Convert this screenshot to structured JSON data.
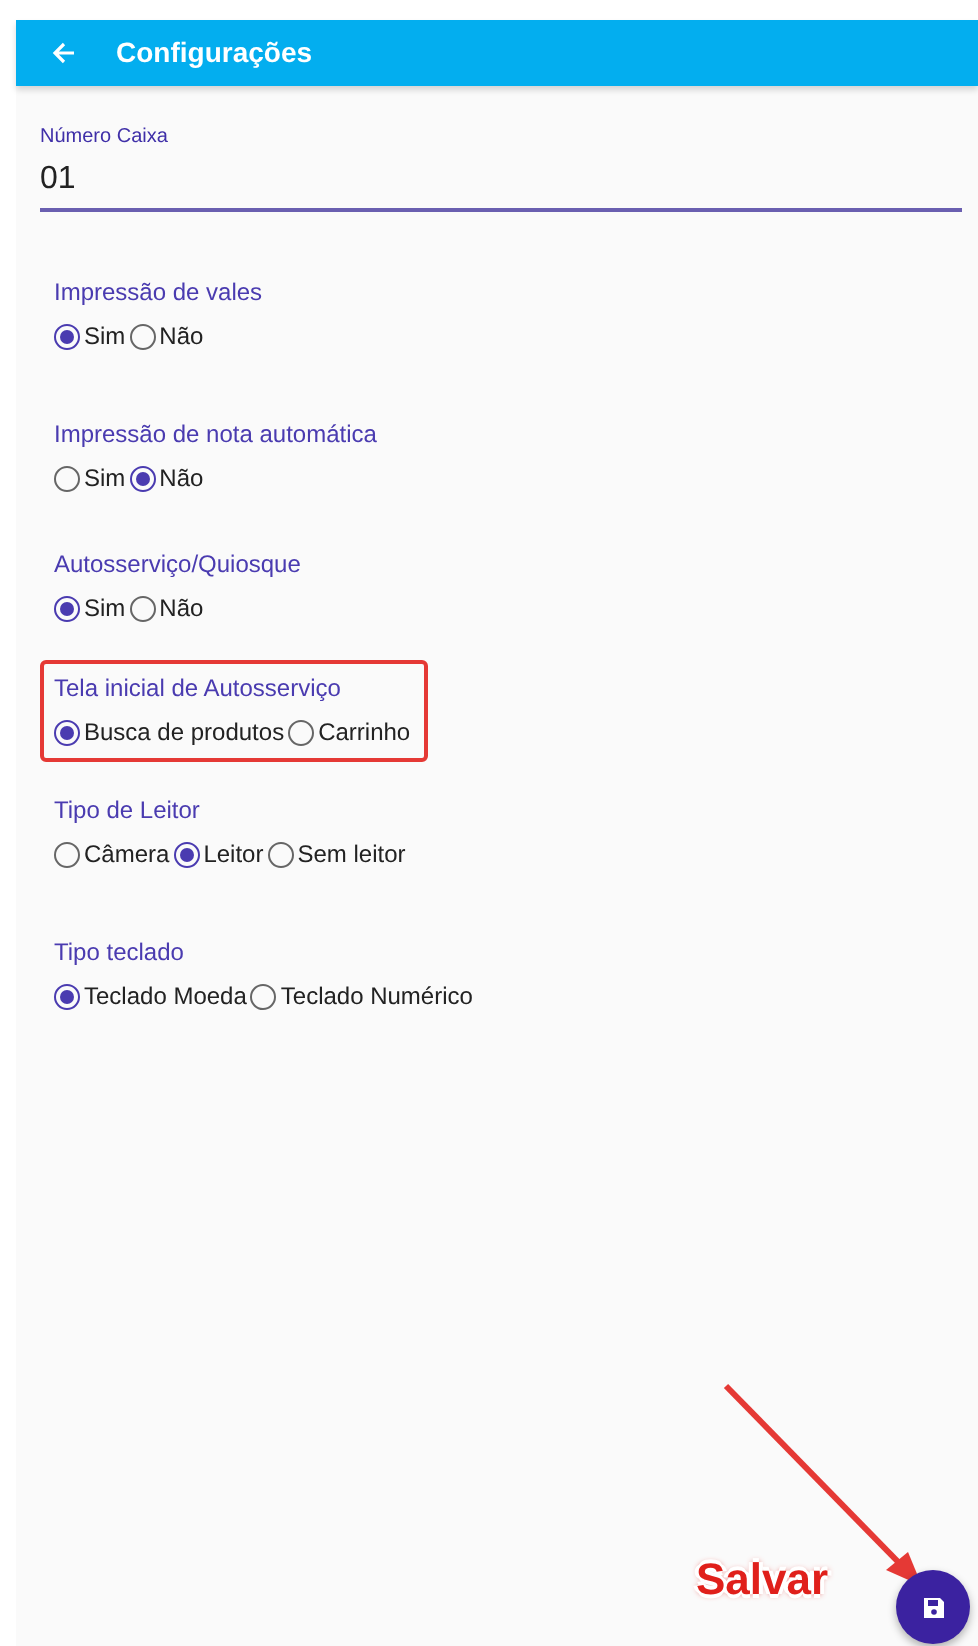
{
  "app_bar": {
    "title": "Configurações"
  },
  "field": {
    "label": "Número Caixa",
    "value": "01"
  },
  "groups": [
    {
      "title": "Impressão de vales",
      "highlighted": false,
      "options": [
        {
          "label": "Sim",
          "selected": true
        },
        {
          "label": "Não",
          "selected": false
        }
      ]
    },
    {
      "title": "Impressão de nota automática",
      "highlighted": false,
      "options": [
        {
          "label": "Sim",
          "selected": false
        },
        {
          "label": "Não",
          "selected": true
        }
      ]
    },
    {
      "title": "Autosserviço/Quiosque",
      "highlighted": false,
      "options": [
        {
          "label": "Sim",
          "selected": true
        },
        {
          "label": "Não",
          "selected": false
        }
      ]
    },
    {
      "title": "Tela inicial de Autosserviço",
      "highlighted": true,
      "options": [
        {
          "label": "Busca de produtos",
          "selected": true
        },
        {
          "label": "Carrinho",
          "selected": false
        }
      ]
    },
    {
      "title": "Tipo de Leitor",
      "highlighted": false,
      "options": [
        {
          "label": "Câmera",
          "selected": false
        },
        {
          "label": "Leitor",
          "selected": true
        },
        {
          "label": "Sem leitor",
          "selected": false
        }
      ]
    },
    {
      "title": "Tipo teclado",
      "highlighted": false,
      "options": [
        {
          "label": "Teclado Moeda",
          "selected": true
        },
        {
          "label": "Teclado Numérico",
          "selected": false
        }
      ]
    }
  ],
  "callout": {
    "text": "Salvar"
  }
}
